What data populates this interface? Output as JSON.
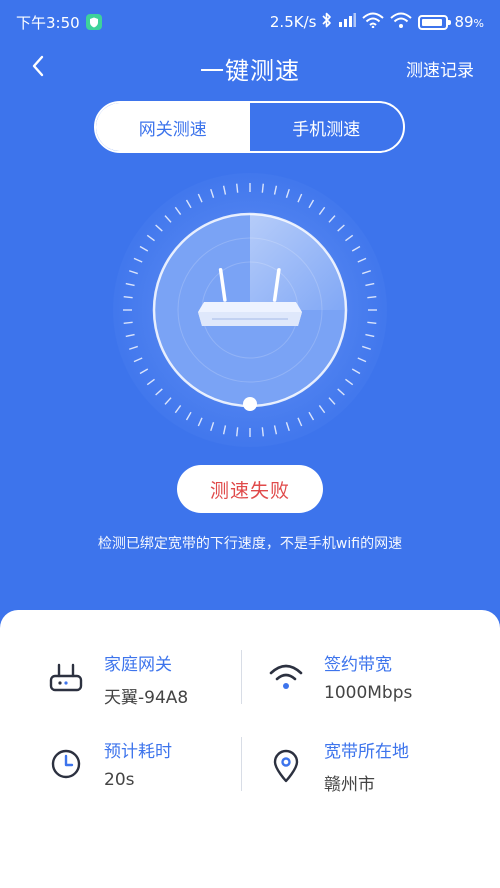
{
  "status_bar": {
    "time": "下午3:50",
    "net_speed": "2.5K/s",
    "battery": "89",
    "battery_unit": "%",
    "battery_level": 0.89
  },
  "nav": {
    "title": "一键测速",
    "history_label": "测速记录",
    "back_icon": "chevron-left-icon"
  },
  "tabs": [
    {
      "label": "网关测速",
      "active": true
    },
    {
      "label": "手机测速",
      "active": false
    }
  ],
  "result": {
    "status_label": "测速失败",
    "hint": "检测已绑定宽带的下行速度，不是手机wifi的网速"
  },
  "info": {
    "gateway": {
      "label": "家庭网关",
      "value": "天翼-94A8",
      "icon": "router-icon"
    },
    "bandwidth": {
      "label": "签约带宽",
      "value": "1000Mbps",
      "icon": "wifi-icon"
    },
    "duration": {
      "label": "预计耗时",
      "value": "20s",
      "icon": "clock-icon"
    },
    "location": {
      "label": "宽带所在地",
      "value": "赣州市",
      "icon": "location-pin-icon"
    }
  },
  "colors": {
    "primary": "#3d74ec",
    "fail_text": "#e04a4a",
    "white": "#ffffff"
  }
}
